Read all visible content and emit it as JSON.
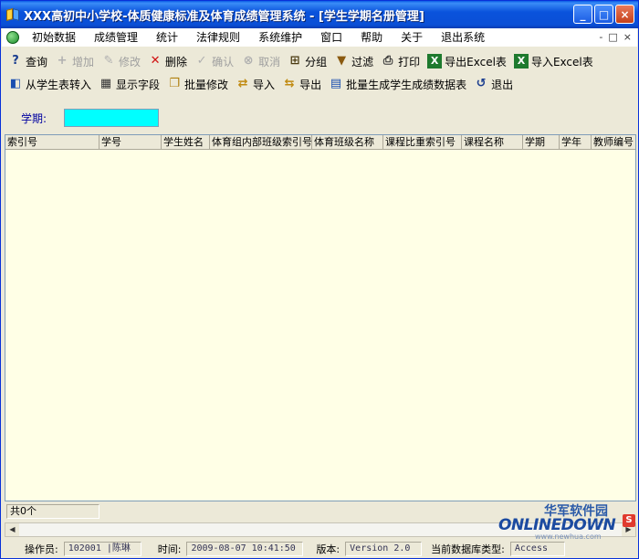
{
  "window": {
    "title": "XXX高初中小学校-体质健康标准及体育成绩管理系统 - [学生学期名册管理]",
    "controls": {
      "minimize": "_",
      "maximize": "□",
      "close": "×"
    }
  },
  "menubar": {
    "items": [
      "初始数据",
      "成绩管理",
      "统计",
      "法律规则",
      "系统维护",
      "窗口",
      "帮助",
      "关于",
      "退出系统"
    ],
    "mdi_controls": [
      "-",
      "□",
      "×"
    ]
  },
  "toolbar1": {
    "items": [
      {
        "label": "查询",
        "icon": "query-icon",
        "enabled": true
      },
      {
        "label": "增加",
        "icon": "add-icon",
        "enabled": false
      },
      {
        "label": "修改",
        "icon": "edit-icon",
        "enabled": false
      },
      {
        "label": "删除",
        "icon": "delete-icon",
        "enabled": true
      },
      {
        "label": "确认",
        "icon": "confirm-icon",
        "enabled": false
      },
      {
        "label": "取消",
        "icon": "cancel-icon",
        "enabled": false
      },
      {
        "label": "分组",
        "icon": "group-icon",
        "enabled": true
      },
      {
        "label": "过滤",
        "icon": "filter-icon",
        "enabled": true
      },
      {
        "label": "打印",
        "icon": "print-icon",
        "enabled": true
      },
      {
        "label": "导出Excel表",
        "icon": "excel-export-icon",
        "enabled": true
      },
      {
        "label": "导入Excel表",
        "icon": "excel-import-icon",
        "enabled": true
      }
    ]
  },
  "toolbar2": {
    "items": [
      {
        "label": "从学生表转入",
        "icon": "transfer-icon"
      },
      {
        "label": "显示字段",
        "icon": "fields-icon"
      },
      {
        "label": "批量修改",
        "icon": "batch-edit-icon"
      },
      {
        "label": "导入",
        "icon": "import-icon"
      },
      {
        "label": "导出",
        "icon": "export-icon"
      },
      {
        "label": "批量生成学生成绩数据表",
        "icon": "batch-generate-icon"
      },
      {
        "label": "退出",
        "icon": "exit-icon"
      }
    ]
  },
  "filter": {
    "label": "学期:",
    "value": ""
  },
  "grid": {
    "columns": [
      "索引号",
      "学号",
      "学生姓名",
      "体育组内部班级索引号",
      "体育班级名称",
      "课程比重索引号",
      "课程名称",
      "学期",
      "学年",
      "教师编号"
    ],
    "rows": []
  },
  "footer": {
    "count_text": "共0个"
  },
  "statusbar": {
    "operator_label": "操作员:",
    "operator_value": "102001 |陈琳",
    "time_label": "时间:",
    "time_value": "2009-08-07 10:41:50",
    "version_label": "版本:",
    "version_value": "Version 2.0",
    "db_label": "当前数据库类型:",
    "db_value": "Access"
  },
  "watermark": {
    "cn": "华军软件园",
    "en": "ONLINEDOWN",
    "url": "www.newhua.com",
    "logo": "S"
  },
  "colors": {
    "title_bar": "#0a53dc",
    "grid_bg": "#ffffe6",
    "filter_input": "#00ffff"
  }
}
